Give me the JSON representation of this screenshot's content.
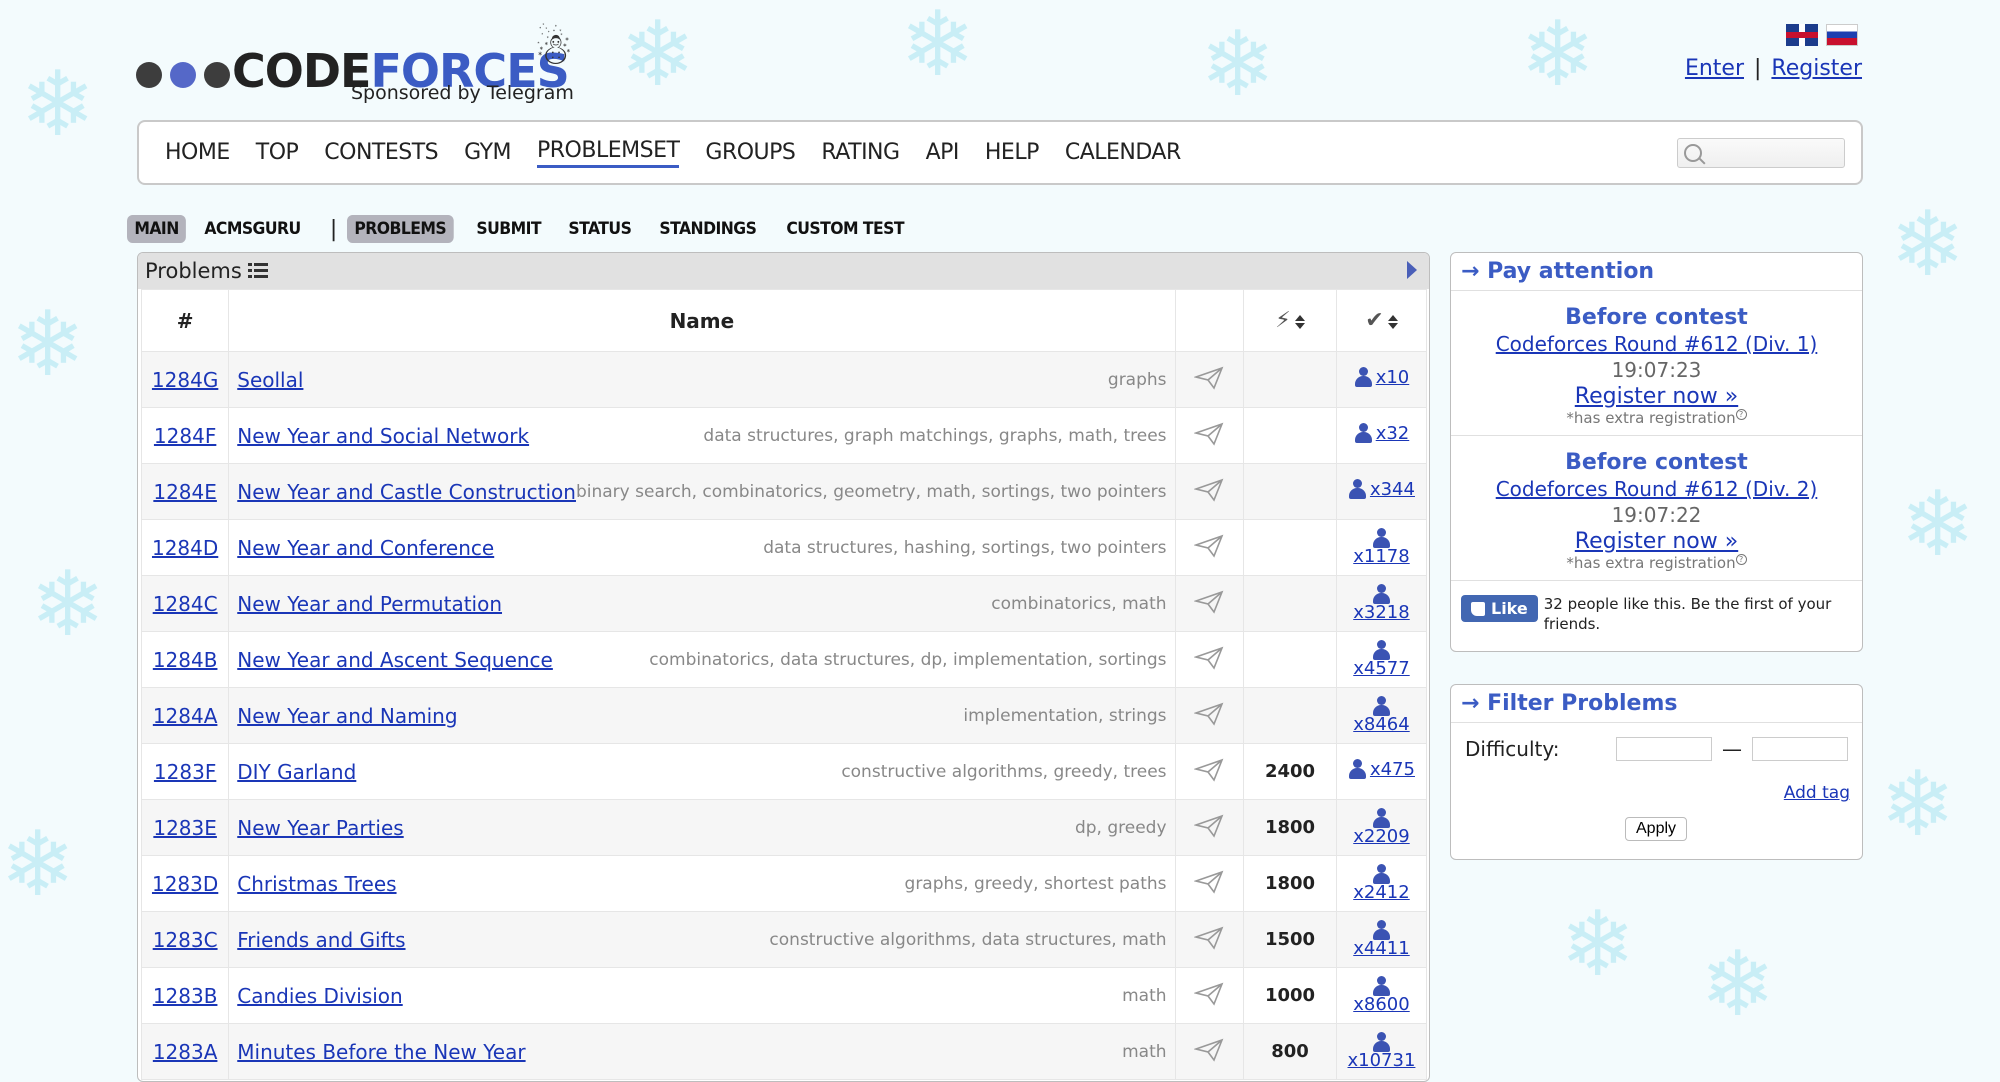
{
  "header": {
    "logo": {
      "word_a": "CODE",
      "word_b": "FORCES",
      "sponsor": "Sponsored by Telegram"
    },
    "auth": {
      "enter": "Enter",
      "separator": "|",
      "register": "Register"
    }
  },
  "menu": {
    "items": [
      "HOME",
      "TOP",
      "CONTESTS",
      "GYM",
      "PROBLEMSET",
      "GROUPS",
      "RATING",
      "API",
      "HELP",
      "CALENDAR"
    ],
    "active": "PROBLEMSET",
    "search_placeholder": ""
  },
  "subtabs": {
    "main": "MAIN",
    "acmsguru": "ACMSGURU",
    "divider": "|",
    "problems": "PROBLEMS",
    "submit": "SUBMIT",
    "status": "STATUS",
    "standings": "STANDINGS",
    "custom_test": "CUSTOM TEST"
  },
  "problems": {
    "title": "Problems",
    "columns": {
      "id": "#",
      "name": "Name"
    },
    "rows": [
      {
        "id": "1284G",
        "name": "Seollal",
        "tags": "graphs",
        "difficulty": "",
        "solved": "x10"
      },
      {
        "id": "1284F",
        "name": "New Year and Social Network",
        "tags": "data structures, graph matchings, graphs, math, trees",
        "difficulty": "",
        "solved": "x32"
      },
      {
        "id": "1284E",
        "name": "New Year and Castle Construction",
        "tags": "binary search, combinatorics, geometry, math, sortings, two pointers",
        "difficulty": "",
        "solved": "x344"
      },
      {
        "id": "1284D",
        "name": "New Year and Conference",
        "tags": "data structures, hashing, sortings, two pointers",
        "difficulty": "",
        "solved": "x1178"
      },
      {
        "id": "1284C",
        "name": "New Year and Permutation",
        "tags": "combinatorics, math",
        "difficulty": "",
        "solved": "x3218"
      },
      {
        "id": "1284B",
        "name": "New Year and Ascent Sequence",
        "tags": "combinatorics, data structures, dp, implementation, sortings",
        "difficulty": "",
        "solved": "x4577"
      },
      {
        "id": "1284A",
        "name": "New Year and Naming",
        "tags": "implementation, strings",
        "difficulty": "",
        "solved": "x8464"
      },
      {
        "id": "1283F",
        "name": "DIY Garland",
        "tags": "constructive algorithms, greedy, trees",
        "difficulty": "2400",
        "solved": "x475"
      },
      {
        "id": "1283E",
        "name": "New Year Parties",
        "tags": "dp, greedy",
        "difficulty": "1800",
        "solved": "x2209"
      },
      {
        "id": "1283D",
        "name": "Christmas Trees",
        "tags": "graphs, greedy, shortest paths",
        "difficulty": "1800",
        "solved": "x2412"
      },
      {
        "id": "1283C",
        "name": "Friends and Gifts",
        "tags": "constructive algorithms, data structures, math",
        "difficulty": "1500",
        "solved": "x4411"
      },
      {
        "id": "1283B",
        "name": "Candies Division",
        "tags": "math",
        "difficulty": "1000",
        "solved": "x8600"
      },
      {
        "id": "1283A",
        "name": "Minutes Before the New Year",
        "tags": "math",
        "difficulty": "800",
        "solved": "x10731"
      }
    ]
  },
  "pay_attention": {
    "caption": "→ Pay attention",
    "contests": [
      {
        "before": "Before contest",
        "name": "Codeforces Round #612 (Div. 1)",
        "timer": "19:07:23",
        "register": "Register now »",
        "note": "*has extra registration"
      },
      {
        "before": "Before contest",
        "name": "Codeforces Round #612 (Div. 2)",
        "timer": "19:07:22",
        "register": "Register now »",
        "note": "*has extra registration"
      }
    ],
    "facebook": {
      "like": "Like",
      "text": "32 people like this. Be the first of your friends."
    }
  },
  "filter": {
    "caption": "→ Filter Problems",
    "difficulty_label": "Difficulty:",
    "dash": "—",
    "add_tag": "Add tag",
    "apply": "Apply"
  }
}
